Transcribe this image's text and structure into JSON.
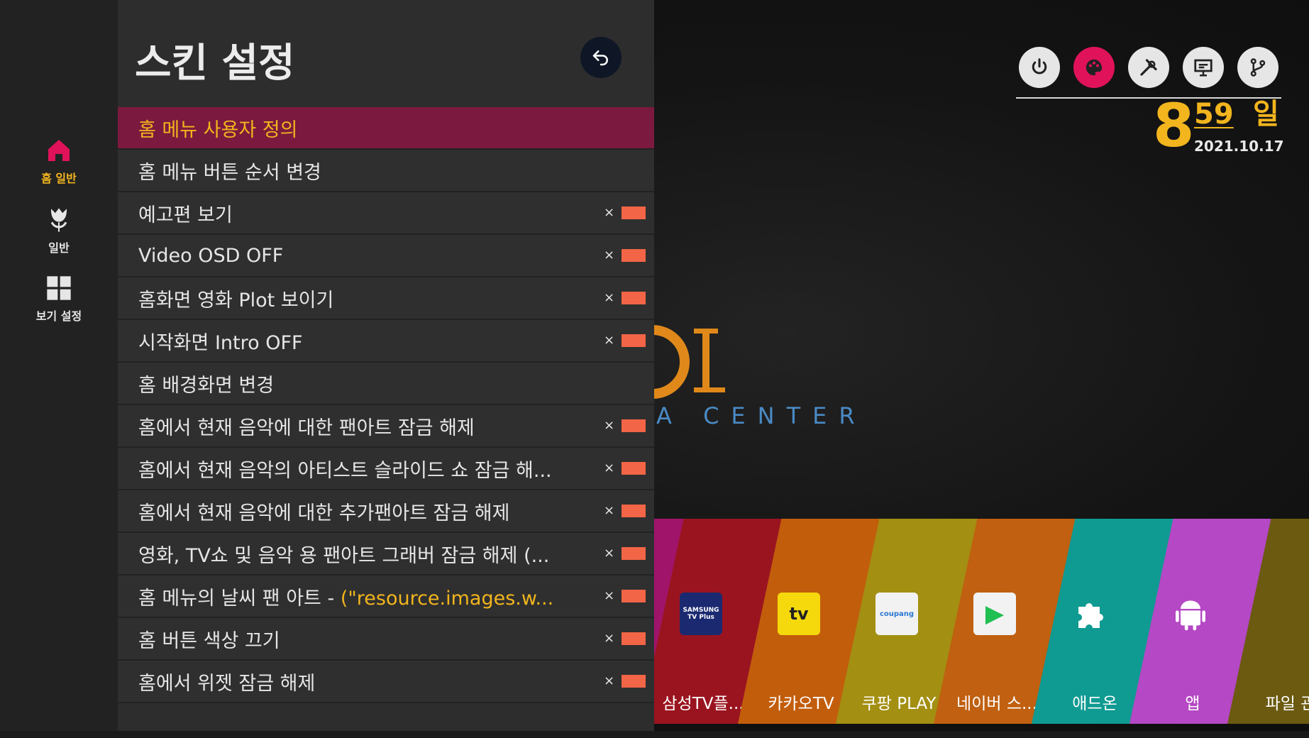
{
  "panel": {
    "title": "스킨 설정",
    "items": [
      {
        "label": "홈 메뉴 사용자 정의",
        "toggle": false,
        "selected": true
      },
      {
        "label": "홈 메뉴 버튼 순서 변경",
        "toggle": false
      },
      {
        "label": "예고편 보기",
        "toggle": true
      },
      {
        "label": "Video OSD OFF",
        "toggle": true
      },
      {
        "label": "홈화면 영화 Plot 보이기",
        "toggle": true
      },
      {
        "label": "시작화면 Intro OFF",
        "toggle": true
      },
      {
        "label": "홈 배경화면 변경",
        "toggle": false
      },
      {
        "label": "홈에서 현재 음악에 대한 팬아트 잠금 해제",
        "toggle": true
      },
      {
        "label": "홈에서 현재 음악의 아티스트 슬라이드 쇼 잠금 해...",
        "toggle": true
      },
      {
        "label": "홈에서 현재 음악에 대한 추가팬아트 잠금 해제",
        "toggle": true
      },
      {
        "label": "영화, TV쇼 및 음악 용 팬아트 그래버 잠금 해제 (...",
        "toggle": true
      },
      {
        "label": "홈 메뉴의 날씨 팬 아트 - ",
        "label_highlight": "(\"resource.images.w...",
        "toggle": true
      },
      {
        "label": "홈 버튼 색상 끄기",
        "toggle": true
      },
      {
        "label": "홈에서 위젯 잠금 해제",
        "toggle": true
      }
    ],
    "toggle_mark": "×"
  },
  "rail": {
    "items": [
      {
        "label": "홈 일반",
        "icon": "home-icon",
        "active": true
      },
      {
        "label": "일반",
        "icon": "tulip-icon"
      },
      {
        "label": "보기 설정",
        "icon": "grid-icon"
      }
    ]
  },
  "top_icons": [
    "power-icon",
    "palette-icon",
    "tools-icon",
    "presentation-icon",
    "branch-icon"
  ],
  "clock": {
    "hour": "8",
    "minute": "59",
    "day": "일",
    "date": "2021.10.17"
  },
  "logo": {
    "text": "A CENTER"
  },
  "tiles": [
    {
      "label": "삼성TV플...",
      "color": "#9a1420",
      "icon_text": "SAMSUNG TV Plus"
    },
    {
      "label": "카카오TV",
      "color": "#c25d0c",
      "icon_text": "tv"
    },
    {
      "label": "쿠팡 PLAY",
      "color": "#a38f12",
      "icon_text": "coupang"
    },
    {
      "label": "네이버 스...",
      "color": "#c06010",
      "icon_text": "▶"
    },
    {
      "label": "애드온",
      "color": "#0f9a92",
      "icon_text": "puzzle"
    },
    {
      "label": "앱",
      "color": "#b548c4",
      "icon_text": "android"
    },
    {
      "label": "파일 관",
      "color": "#6b5a10",
      "icon_text": ""
    }
  ],
  "colors": {
    "accent": "#f2b51e",
    "selected_row": "#7b1a3e",
    "toggle_off": "#f26546",
    "active_icon": "#e0125a"
  }
}
